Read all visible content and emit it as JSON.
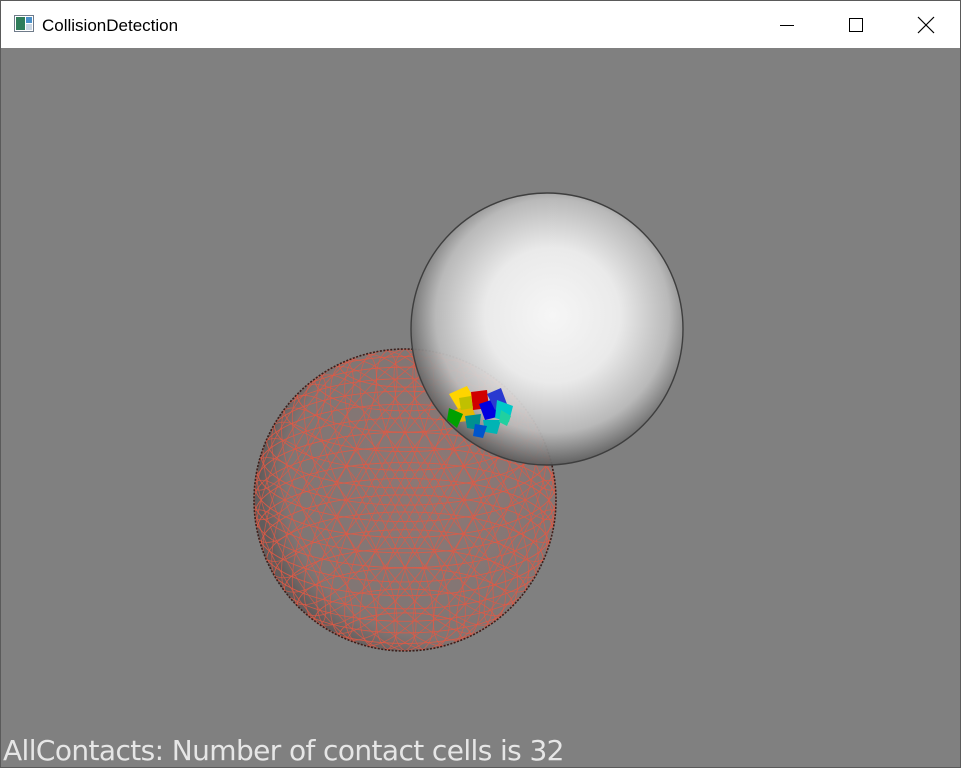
{
  "window": {
    "title": "CollisionDetection",
    "icon": "vtk-app-icon",
    "controls": [
      "minimize-icon",
      "maximize-icon",
      "close-icon"
    ]
  },
  "scene": {
    "background_color": "#808080",
    "objects": [
      {
        "name": "wireframe-sphere",
        "color": "#e05a45",
        "style": "wireframe"
      },
      {
        "name": "solid-sphere",
        "color": "#ffffff",
        "style": "translucent-shaded"
      },
      {
        "name": "contact-cells",
        "colors": [
          "#ffd400",
          "#00a000",
          "#d00000",
          "#0000e0",
          "#00c8c8"
        ]
      }
    ]
  },
  "status": {
    "text": "AllContacts: Number of contact cells is 32"
  }
}
